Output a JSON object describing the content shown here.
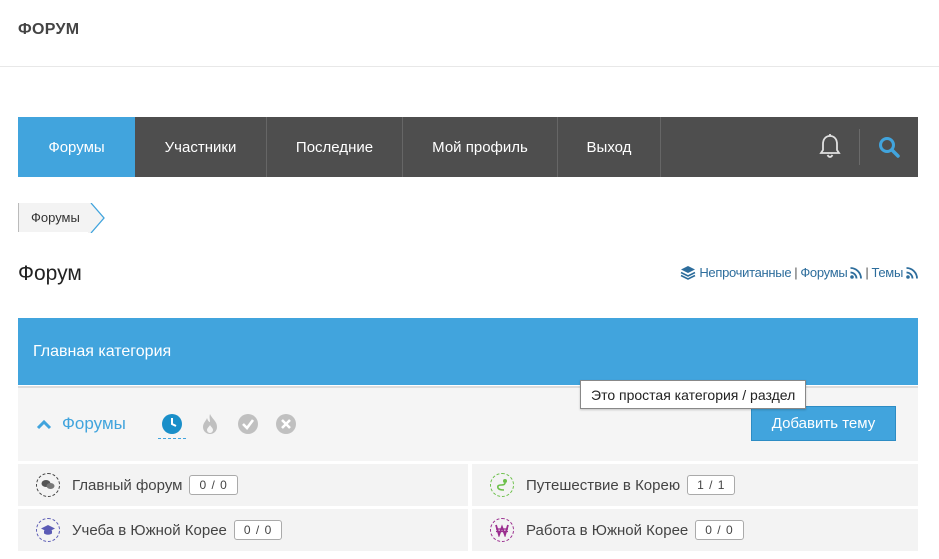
{
  "site": {
    "title": "ФОРУМ"
  },
  "nav": {
    "items": [
      {
        "label": "Форумы",
        "active": true
      },
      {
        "label": "Участники"
      },
      {
        "label": "Последние"
      },
      {
        "label": "Мой профиль"
      },
      {
        "label": "Выход"
      }
    ],
    "icons": [
      "bell-icon",
      "search-icon"
    ]
  },
  "breadcrumb": {
    "item": "Форумы"
  },
  "page": {
    "title": "Форум"
  },
  "feeds": {
    "unread": "Непрочитанные",
    "sep1": "|",
    "forums": "Форумы",
    "sep2": "|",
    "topics": "Темы"
  },
  "category": {
    "title": "Главная категория",
    "toggle_label": "Форумы",
    "add_button": "Добавить тему",
    "tooltip": "Это простая категория / раздел",
    "filter_icons": [
      "clock-icon",
      "fire-icon",
      "check-icon",
      "close-icon"
    ]
  },
  "forums": [
    {
      "name": "Главный форум",
      "count": "0 / 0",
      "icon": "chat-icon",
      "color": "#555555"
    },
    {
      "name": "Путешествие в Корею",
      "count": "1 / 1",
      "icon": "route-icon",
      "color": "#6cc04a"
    },
    {
      "name": "Учеба в Южной Корее",
      "count": "0 / 0",
      "icon": "graduation-cap-icon",
      "color": "#5b5bb5"
    },
    {
      "name": "Работа в Южной Корее",
      "count": "0 / 0",
      "icon": "won-icon",
      "color": "#9b2f8f"
    }
  ],
  "colors": {
    "accent": "#41a4dd",
    "nav_bg": "#4e4e4e"
  }
}
